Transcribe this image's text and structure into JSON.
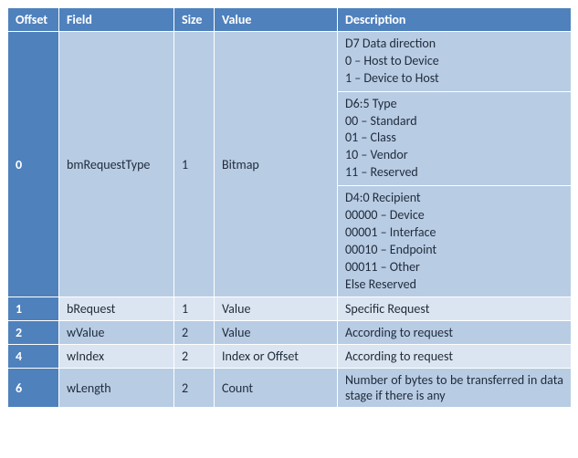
{
  "headers": {
    "offset": "Offset",
    "field": "Field",
    "size": "Size",
    "value": "Value",
    "description": "Description"
  },
  "rows": {
    "r0": {
      "offset": "0",
      "field": "bmRequestType",
      "size": "1",
      "value": "Bitmap",
      "desc_a": {
        "l0": "D7 Data direction",
        "l1": "0 – Host to Device",
        "l2": "1 – Device to Host"
      },
      "desc_b": {
        "l0": "D6:5 Type",
        "l1": "00 – Standard",
        "l2": "01 – Class",
        "l3": "10 – Vendor",
        "l4": "11 – Reserved"
      },
      "desc_c": {
        "l0": "D4:0 Recipient",
        "l1": "00000 – Device",
        "l2": "00001 – Interface",
        "l3": "00010 – Endpoint",
        "l4": "00011 – Other",
        "l5": "Else Reserved"
      }
    },
    "r1": {
      "offset": "1",
      "field": "bRequest",
      "size": "1",
      "value": "Value",
      "description": "Specific Request"
    },
    "r2": {
      "offset": "2",
      "field": "wValue",
      "size": "2",
      "value": "Value",
      "description": "According to request"
    },
    "r3": {
      "offset": "4",
      "field": "wIndex",
      "size": "2",
      "value": "Index or Offset",
      "description": "According to request"
    },
    "r4": {
      "offset": "6",
      "field": "wLength",
      "size": "2",
      "value": "Count",
      "description": "Number of bytes to be transferred in data stage if there is any"
    }
  }
}
